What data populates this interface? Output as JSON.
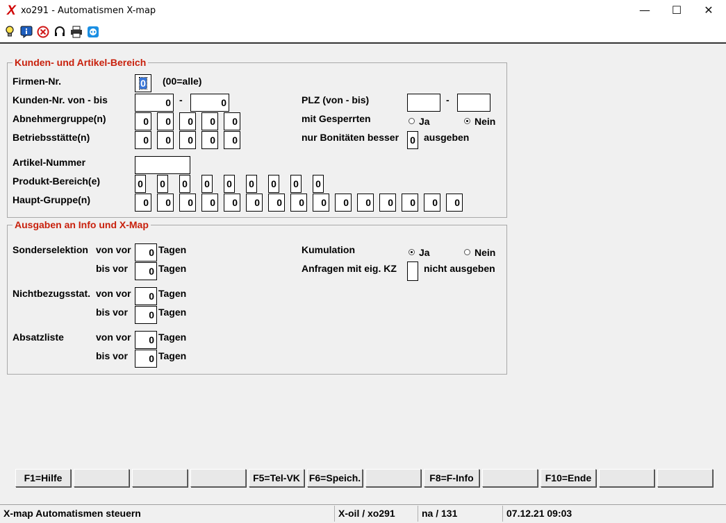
{
  "window": {
    "title": "xo291 - Automatismen X-map",
    "logo": "X",
    "minimize": "—",
    "maximize": "☐",
    "close": "✕"
  },
  "toolbar": {
    "icons": [
      "lightbulb-icon",
      "info-icon",
      "cancel-icon",
      "headset-icon",
      "printer-icon",
      "teamviewer-icon"
    ]
  },
  "section1": {
    "legend": "Kunden- und Artikel-Bereich",
    "firmen_label": "Firmen-Nr.",
    "firmen_value": "0",
    "firmen_hint": "(00=alle)",
    "kunden_label": "Kunden-Nr. von - bis",
    "kunden_from": "0",
    "kunden_dash": "-",
    "kunden_to": "0",
    "abnehmer_label": "Abnehmergruppe(n)",
    "abnehmer_values": [
      "0",
      "0",
      "0",
      "0",
      "0"
    ],
    "betrieb_label": "Betriebsstätte(n)",
    "betrieb_values": [
      "0",
      "0",
      "0",
      "0",
      "0"
    ],
    "artikel_label": "Artikel-Nummer",
    "artikel_value": "",
    "produkt_label": "Produkt-Bereich(e)",
    "produkt_values": [
      "0",
      "0",
      "0",
      "0",
      "0",
      "0",
      "0",
      "0",
      "0"
    ],
    "haupt_label": "Haupt-Gruppe(n)",
    "haupt_values": [
      "0",
      "0",
      "0",
      "0",
      "0",
      "0",
      "0",
      "0",
      "0",
      "0",
      "0",
      "0",
      "0",
      "0",
      "0"
    ],
    "plz_label": "PLZ (von - bis)",
    "plz_from": "",
    "plz_dash": "-",
    "plz_to": "",
    "gesperrt_label": "mit Gesperrten",
    "gesperrt_ja": "Ja",
    "gesperrt_nein": "Nein",
    "bon_label": "nur Bonitäten besser",
    "bon_value": "0",
    "bon_suffix": "ausgeben"
  },
  "section2": {
    "legend": "Ausgaben an Info und X-Map",
    "sonder_label": "Sonderselektion",
    "von_vor": "von vor",
    "bis_vor": "bis vor",
    "tagen": "Tagen",
    "sonder_from": "0",
    "sonder_to": "0",
    "nichtbezug_label": "Nichtbezugsstat.",
    "nichtbezug_from": "0",
    "nichtbezug_to": "0",
    "absatz_label": "Absatzliste",
    "absatz_from": "0",
    "absatz_to": "0",
    "kumulation_label": "Kumulation",
    "kum_ja": "Ja",
    "kum_nein": "Nein",
    "anfragen_label": "Anfragen mit eig. KZ",
    "anfragen_value": "",
    "anfragen_suffix": "nicht ausgeben"
  },
  "fkeys": [
    "F1=Hilfe",
    "",
    "",
    "",
    "F5=Tel-VK",
    "F6=Speich.",
    "",
    "F8=F-Info",
    "",
    "F10=Ende",
    "",
    ""
  ],
  "status": {
    "text": "X-map Automatismen steuern",
    "system": "X-oil / xo291",
    "user": "na / 131",
    "datetime": "07.12.21 09:03"
  }
}
